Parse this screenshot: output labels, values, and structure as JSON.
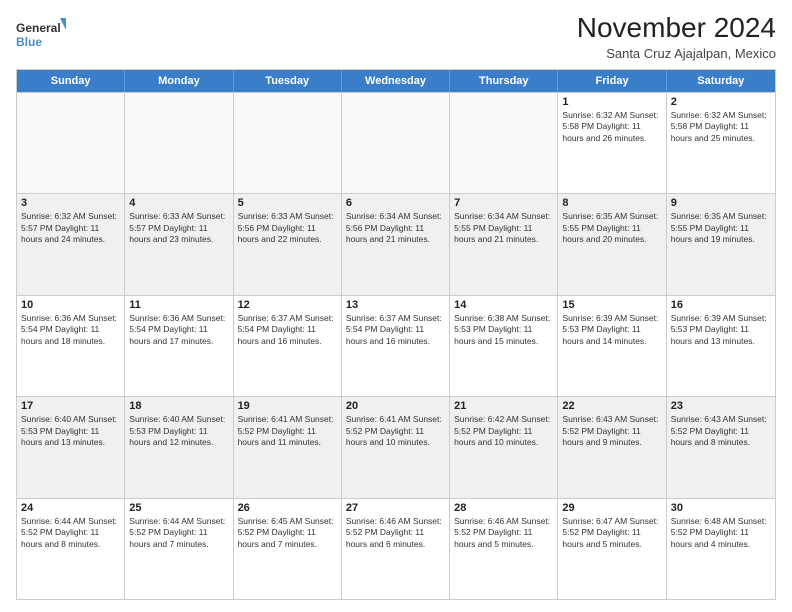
{
  "logo": {
    "line1": "General",
    "line2": "Blue"
  },
  "title": "November 2024",
  "subtitle": "Santa Cruz Ajajalpan, Mexico",
  "header_days": [
    "Sunday",
    "Monday",
    "Tuesday",
    "Wednesday",
    "Thursday",
    "Friday",
    "Saturday"
  ],
  "weeks": [
    [
      {
        "day": "",
        "info": ""
      },
      {
        "day": "",
        "info": ""
      },
      {
        "day": "",
        "info": ""
      },
      {
        "day": "",
        "info": ""
      },
      {
        "day": "",
        "info": ""
      },
      {
        "day": "1",
        "info": "Sunrise: 6:32 AM\nSunset: 5:58 PM\nDaylight: 11 hours and 26 minutes."
      },
      {
        "day": "2",
        "info": "Sunrise: 6:32 AM\nSunset: 5:58 PM\nDaylight: 11 hours and 25 minutes."
      }
    ],
    [
      {
        "day": "3",
        "info": "Sunrise: 6:32 AM\nSunset: 5:57 PM\nDaylight: 11 hours and 24 minutes."
      },
      {
        "day": "4",
        "info": "Sunrise: 6:33 AM\nSunset: 5:57 PM\nDaylight: 11 hours and 23 minutes."
      },
      {
        "day": "5",
        "info": "Sunrise: 6:33 AM\nSunset: 5:56 PM\nDaylight: 11 hours and 22 minutes."
      },
      {
        "day": "6",
        "info": "Sunrise: 6:34 AM\nSunset: 5:56 PM\nDaylight: 11 hours and 21 minutes."
      },
      {
        "day": "7",
        "info": "Sunrise: 6:34 AM\nSunset: 5:55 PM\nDaylight: 11 hours and 21 minutes."
      },
      {
        "day": "8",
        "info": "Sunrise: 6:35 AM\nSunset: 5:55 PM\nDaylight: 11 hours and 20 minutes."
      },
      {
        "day": "9",
        "info": "Sunrise: 6:35 AM\nSunset: 5:55 PM\nDaylight: 11 hours and 19 minutes."
      }
    ],
    [
      {
        "day": "10",
        "info": "Sunrise: 6:36 AM\nSunset: 5:54 PM\nDaylight: 11 hours and 18 minutes."
      },
      {
        "day": "11",
        "info": "Sunrise: 6:36 AM\nSunset: 5:54 PM\nDaylight: 11 hours and 17 minutes."
      },
      {
        "day": "12",
        "info": "Sunrise: 6:37 AM\nSunset: 5:54 PM\nDaylight: 11 hours and 16 minutes."
      },
      {
        "day": "13",
        "info": "Sunrise: 6:37 AM\nSunset: 5:54 PM\nDaylight: 11 hours and 16 minutes."
      },
      {
        "day": "14",
        "info": "Sunrise: 6:38 AM\nSunset: 5:53 PM\nDaylight: 11 hours and 15 minutes."
      },
      {
        "day": "15",
        "info": "Sunrise: 6:39 AM\nSunset: 5:53 PM\nDaylight: 11 hours and 14 minutes."
      },
      {
        "day": "16",
        "info": "Sunrise: 6:39 AM\nSunset: 5:53 PM\nDaylight: 11 hours and 13 minutes."
      }
    ],
    [
      {
        "day": "17",
        "info": "Sunrise: 6:40 AM\nSunset: 5:53 PM\nDaylight: 11 hours and 13 minutes."
      },
      {
        "day": "18",
        "info": "Sunrise: 6:40 AM\nSunset: 5:53 PM\nDaylight: 11 hours and 12 minutes."
      },
      {
        "day": "19",
        "info": "Sunrise: 6:41 AM\nSunset: 5:52 PM\nDaylight: 11 hours and 11 minutes."
      },
      {
        "day": "20",
        "info": "Sunrise: 6:41 AM\nSunset: 5:52 PM\nDaylight: 11 hours and 10 minutes."
      },
      {
        "day": "21",
        "info": "Sunrise: 6:42 AM\nSunset: 5:52 PM\nDaylight: 11 hours and 10 minutes."
      },
      {
        "day": "22",
        "info": "Sunrise: 6:43 AM\nSunset: 5:52 PM\nDaylight: 11 hours and 9 minutes."
      },
      {
        "day": "23",
        "info": "Sunrise: 6:43 AM\nSunset: 5:52 PM\nDaylight: 11 hours and 8 minutes."
      }
    ],
    [
      {
        "day": "24",
        "info": "Sunrise: 6:44 AM\nSunset: 5:52 PM\nDaylight: 11 hours and 8 minutes."
      },
      {
        "day": "25",
        "info": "Sunrise: 6:44 AM\nSunset: 5:52 PM\nDaylight: 11 hours and 7 minutes."
      },
      {
        "day": "26",
        "info": "Sunrise: 6:45 AM\nSunset: 5:52 PM\nDaylight: 11 hours and 7 minutes."
      },
      {
        "day": "27",
        "info": "Sunrise: 6:46 AM\nSunset: 5:52 PM\nDaylight: 11 hours and 6 minutes."
      },
      {
        "day": "28",
        "info": "Sunrise: 6:46 AM\nSunset: 5:52 PM\nDaylight: 11 hours and 5 minutes."
      },
      {
        "day": "29",
        "info": "Sunrise: 6:47 AM\nSunset: 5:52 PM\nDaylight: 11 hours and 5 minutes."
      },
      {
        "day": "30",
        "info": "Sunrise: 6:48 AM\nSunset: 5:52 PM\nDaylight: 11 hours and 4 minutes."
      }
    ]
  ]
}
